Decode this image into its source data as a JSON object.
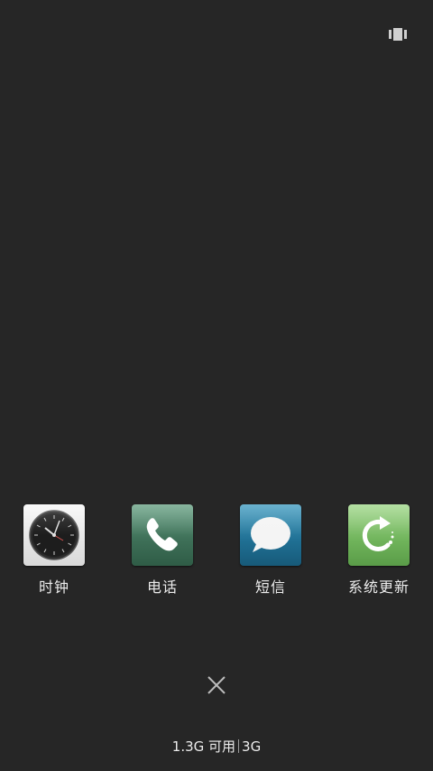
{
  "apps": [
    {
      "label": "时钟",
      "icon": "clock-icon"
    },
    {
      "label": "电话",
      "icon": "phone-icon"
    },
    {
      "label": "短信",
      "icon": "message-icon"
    },
    {
      "label": "系统更新",
      "icon": "system-update-icon"
    }
  ],
  "footer": {
    "memory_available": "1.3G 可用",
    "memory_total": "3G"
  },
  "colors": {
    "background": "#262626",
    "phone": "#3f7159",
    "sms": "#1f6f93",
    "update": "#6fb35a"
  }
}
